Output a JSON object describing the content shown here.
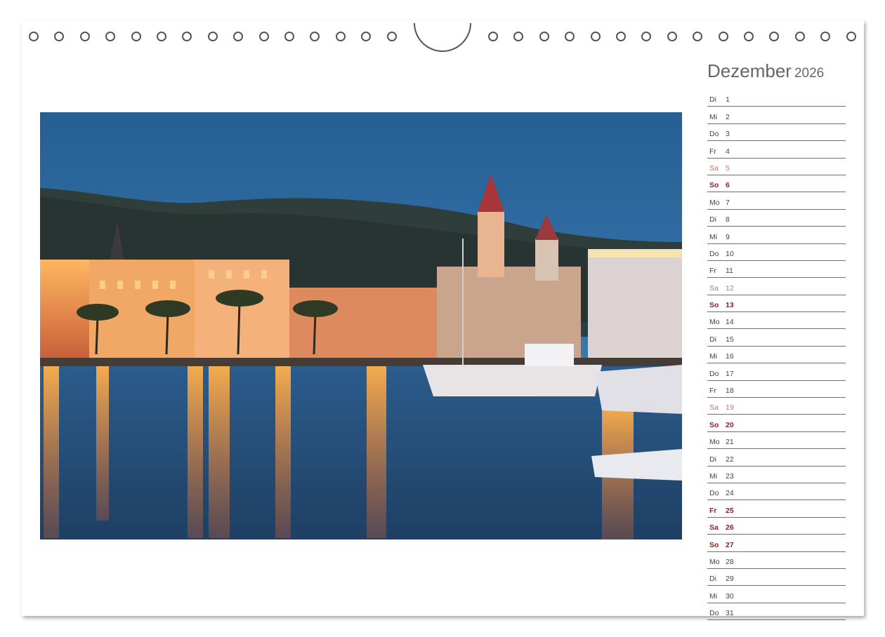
{
  "calendar": {
    "month": "Dezember",
    "year": "2026",
    "days": [
      {
        "wd": "Di",
        "d": "1",
        "type": "weekday"
      },
      {
        "wd": "Mi",
        "d": "2",
        "type": "weekday"
      },
      {
        "wd": "Do",
        "d": "3",
        "type": "weekday"
      },
      {
        "wd": "Fr",
        "d": "4",
        "type": "weekday"
      },
      {
        "wd": "Sa",
        "d": "5",
        "type": "saturday"
      },
      {
        "wd": "So",
        "d": "6",
        "type": "sunday"
      },
      {
        "wd": "Mo",
        "d": "7",
        "type": "weekday"
      },
      {
        "wd": "Di",
        "d": "8",
        "type": "weekday"
      },
      {
        "wd": "Mi",
        "d": "9",
        "type": "weekday"
      },
      {
        "wd": "Do",
        "d": "10",
        "type": "weekday"
      },
      {
        "wd": "Fr",
        "d": "11",
        "type": "weekday"
      },
      {
        "wd": "Sa",
        "d": "12",
        "type": "saturday"
      },
      {
        "wd": "So",
        "d": "13",
        "type": "sunday"
      },
      {
        "wd": "Mo",
        "d": "14",
        "type": "weekday"
      },
      {
        "wd": "Di",
        "d": "15",
        "type": "weekday"
      },
      {
        "wd": "Mi",
        "d": "16",
        "type": "weekday"
      },
      {
        "wd": "Do",
        "d": "17",
        "type": "weekday"
      },
      {
        "wd": "Fr",
        "d": "18",
        "type": "weekday"
      },
      {
        "wd": "Sa",
        "d": "19",
        "type": "saturday"
      },
      {
        "wd": "So",
        "d": "20",
        "type": "sunday"
      },
      {
        "wd": "Mo",
        "d": "21",
        "type": "weekday"
      },
      {
        "wd": "Di",
        "d": "22",
        "type": "weekday"
      },
      {
        "wd": "Mi",
        "d": "23",
        "type": "weekday"
      },
      {
        "wd": "Do",
        "d": "24",
        "type": "weekday"
      },
      {
        "wd": "Fr",
        "d": "25",
        "type": "holiday"
      },
      {
        "wd": "Sa",
        "d": "26",
        "type": "holiday"
      },
      {
        "wd": "So",
        "d": "27",
        "type": "sunday"
      },
      {
        "wd": "Mo",
        "d": "28",
        "type": "weekday"
      },
      {
        "wd": "Di",
        "d": "29",
        "type": "weekday"
      },
      {
        "wd": "Mi",
        "d": "30",
        "type": "weekday"
      },
      {
        "wd": "Do",
        "d": "31",
        "type": "weekday"
      }
    ]
  },
  "photo": {
    "subject": "harbor-town-at-dusk"
  },
  "colors": {
    "saturday": "#c8785a",
    "sunday": "#8a1f1f",
    "sky": "#2f6a9e",
    "water": "#2a4f7a",
    "lights": "#f4a340"
  }
}
